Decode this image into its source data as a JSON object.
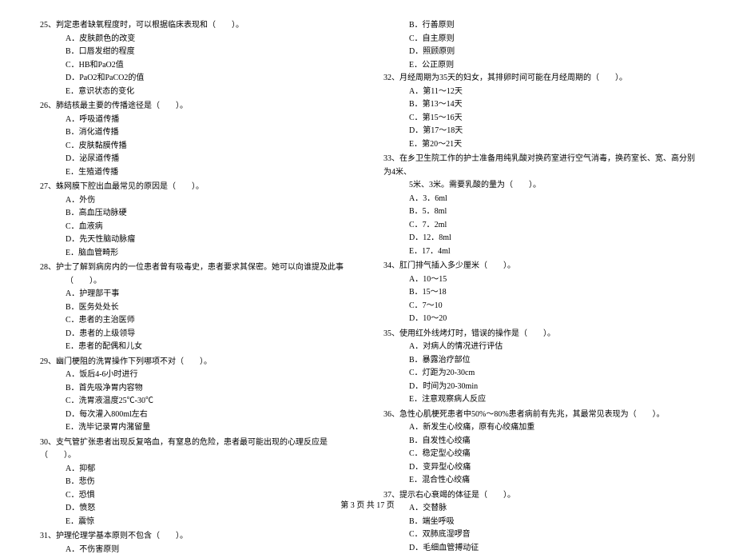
{
  "left_column": {
    "questions": [
      {
        "num": "25、",
        "text": "判定患者缺氧程度时，可以根据临床表现和（　　）。",
        "options": [
          "A．皮肤颜色的改变",
          "B．口唇发绀的程度",
          "C．HB和PaO2值",
          "D．PaO2和PaCO2的值",
          "E．意识状态的变化"
        ]
      },
      {
        "num": "26、",
        "text": "肺结核最主要的传播途径是（　　）。",
        "options": [
          "A．呼吸道传播",
          "B．消化道传播",
          "C．皮肤黏膜传播",
          "D．泌尿道传播",
          "E．生殖道传播"
        ]
      },
      {
        "num": "27、",
        "text": "蛛网膜下腔出血最常见的原因是（　　）。",
        "options": [
          "A．外伤",
          "B．高血压动脉硬",
          "C．血液病",
          "D．先天性脑动脉瘤",
          "E．脑血管畸形"
        ]
      },
      {
        "num": "28、",
        "text": "护士了解到病房内的一位患者曾有吸毒史，患者要求其保密。她可以向谁提及此事",
        "continuation": "（　　）。",
        "options": [
          "A．护理部干事",
          "B．医务处处长",
          "C．患者的主治医师",
          "D．患者的上级领导",
          "E．患者的配偶和儿女"
        ]
      },
      {
        "num": "29、",
        "text": "幽门梗阻的洗胃操作下列哪项不对（　　）。",
        "options": [
          "A．饭后4-6小时进行",
          "B．首先吸净胃内容物",
          "C．洗胃液温度25℃-30℃",
          "D．每次灌入800ml左右",
          "E．洗毕记录胃内潴留量"
        ]
      },
      {
        "num": "30、",
        "text": "支气管扩张患者出现反复咯血，有窒息的危险，患者最可能出现的心理反应是（　　）。",
        "options": [
          "A．抑郁",
          "B．悲伤",
          "C．恐惧",
          "D．愤怒",
          "E．震惊"
        ]
      },
      {
        "num": "31、",
        "text": "护理伦理学基本原则不包含（　　）。",
        "options": [
          "A．不伤害原则"
        ]
      }
    ]
  },
  "right_column": {
    "orphan_options": [
      "B．行善原则",
      "C．自主原则",
      "D．照顾原则",
      "E．公正原则"
    ],
    "questions": [
      {
        "num": "32、",
        "text": "月经周期为35天的妇女，其排卵时间可能在月经周期的（　　）。",
        "options": [
          "A．第11～12天",
          "B．第13～14天",
          "C．第15～16天",
          "D．第17～18天",
          "E．第20～21天"
        ]
      },
      {
        "num": "33、",
        "text": "在乡卫生院工作的护士准备用纯乳酸对换药室进行空气消毒，换药室长、宽、高分别为4米、",
        "continuation": "5米、3米。需要乳酸的量为（　　）。",
        "options": [
          "A．3．6ml",
          "B．5．8ml",
          "C．7．2ml",
          "D．12．8ml",
          "E．17．4ml"
        ]
      },
      {
        "num": "34、",
        "text": "肛门排气插入多少厘米（　　）。",
        "options": [
          "A．10～15",
          "B．15～18",
          "C．7～10",
          "D．10～20"
        ]
      },
      {
        "num": "35、",
        "text": "使用红外线烤灯时，错误的操作是（　　）。",
        "options": [
          "A．对病人的情况进行评估",
          "B．暴露治疗部位",
          "C．灯距为20-30cm",
          "D．时间为20-30min",
          "E．注意观察病人反应"
        ]
      },
      {
        "num": "36、",
        "text": "急性心肌梗死患者中50%～80%患者病前有先兆，其最常见表现为（　　）。",
        "options": [
          "A．新发生心绞痛，原有心绞痛加重",
          "B．自发性心绞痛",
          "C．稳定型心绞痛",
          "D．变异型心绞痛",
          "E．混合性心绞痛"
        ]
      },
      {
        "num": "37、",
        "text": "提示右心衰竭的体征是（　　）。",
        "options": [
          "A．交替脉",
          "B．端坐呼吸",
          "C．双肺底湿啰音",
          "D．毛细血管搏动征"
        ]
      }
    ]
  },
  "footer": "第 3 页 共 17 页"
}
